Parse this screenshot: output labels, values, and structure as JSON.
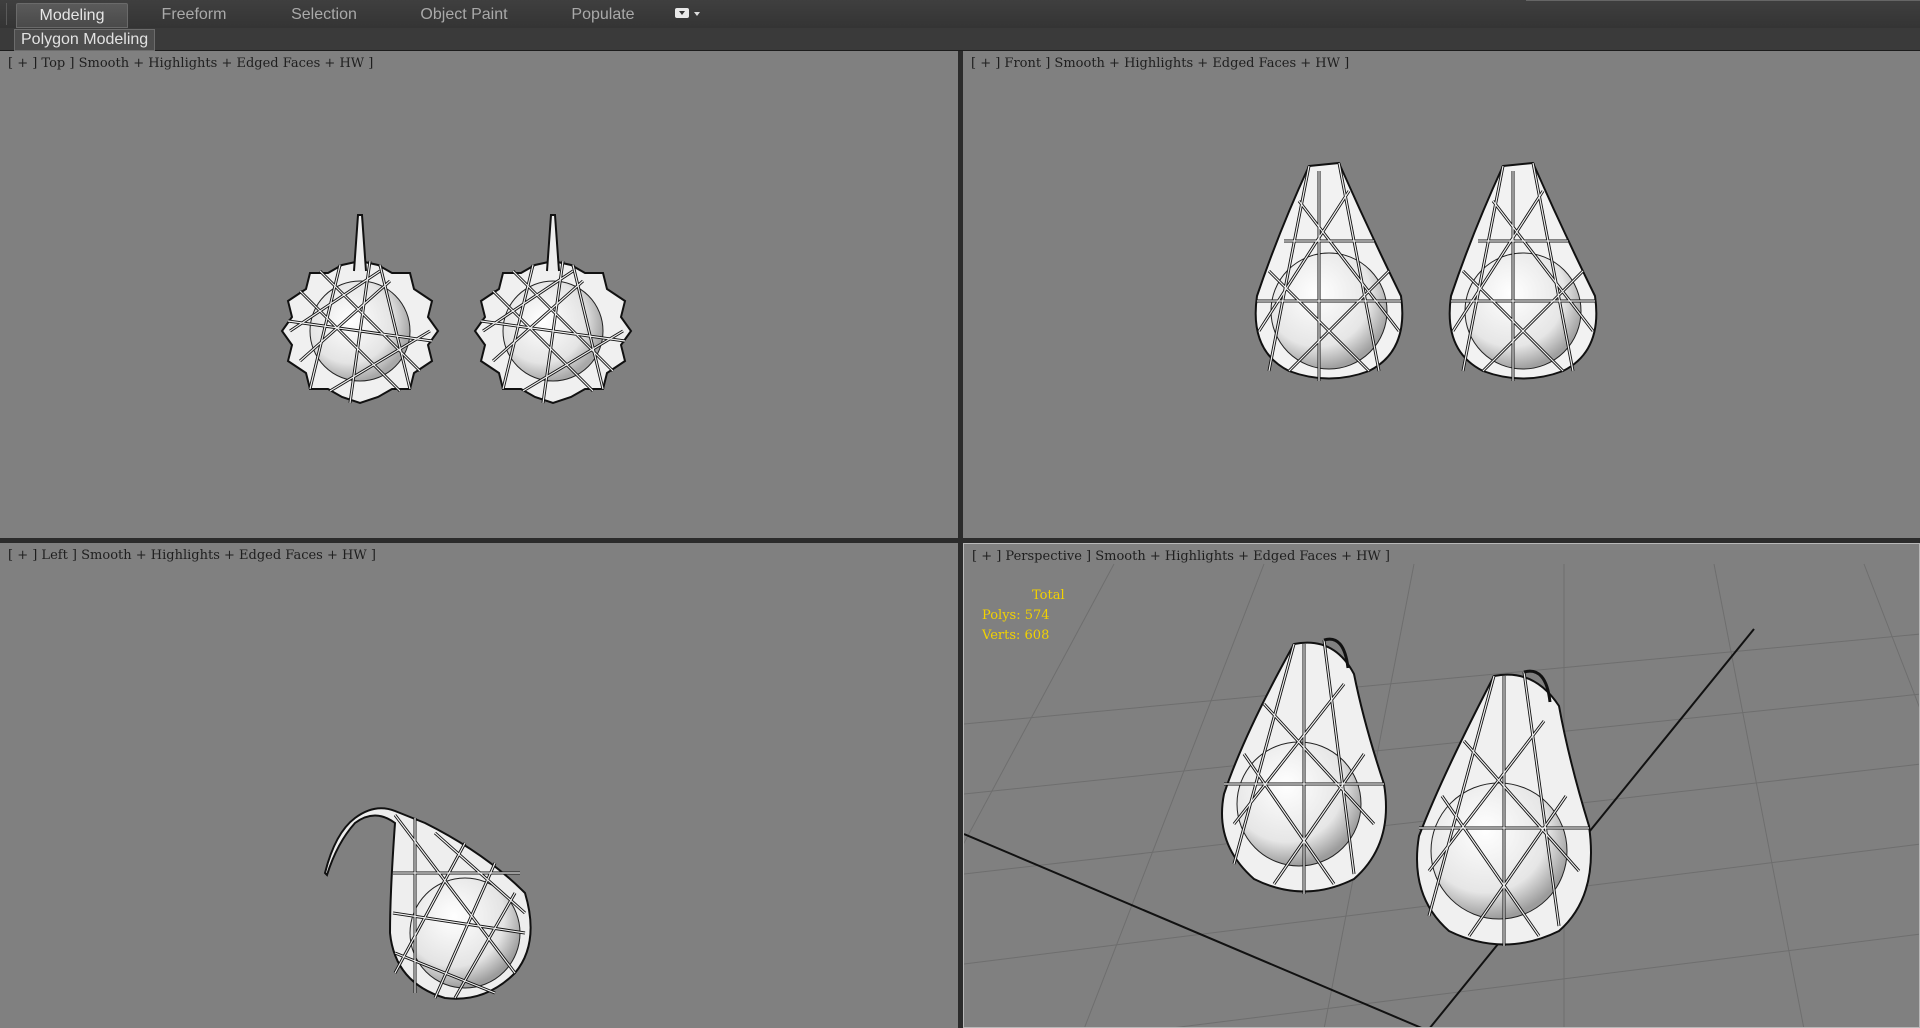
{
  "ribbon": {
    "tabs": [
      {
        "label": "Modeling",
        "active": true
      },
      {
        "label": "Freeform",
        "active": false
      },
      {
        "label": "Selection",
        "active": false
      },
      {
        "label": "Object Paint",
        "active": false
      },
      {
        "label": "Populate",
        "active": false
      }
    ],
    "options_icon": "ribbon-options-icon",
    "panel_label": "Polygon Modeling"
  },
  "viewports": {
    "top": {
      "label": "[ + ] Top ] Smooth + Highlights + Edged Faces + HW ]"
    },
    "front": {
      "label": "[ + ] Front ] Smooth + Highlights + Edged Faces + HW ]"
    },
    "left": {
      "label": "[ + ] Left ] Smooth + Highlights + Edged Faces + HW ]"
    },
    "perspective": {
      "label": "[ + ] Perspective ] Smooth + Highlights + Edged Faces + HW ]"
    }
  },
  "stats": {
    "title": "Total",
    "polys_label": "Polys:",
    "polys_value": "574",
    "verts_label": "Verts:",
    "verts_value": "608"
  },
  "colors": {
    "viewport_bg": "#808080",
    "ui_bg": "#3a3a3a",
    "stats_text": "#f2d200",
    "label_text": "#1e1e1e"
  }
}
